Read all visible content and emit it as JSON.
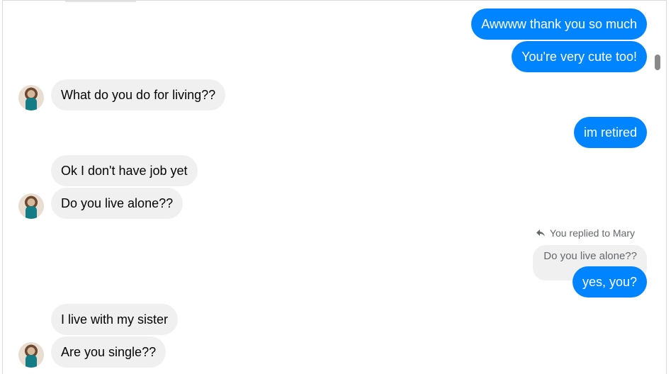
{
  "messages": {
    "m1": "Awwww thank you so much",
    "m2": "You're very cute too!",
    "m3": "What do you do for living??",
    "m4": "im retired",
    "m5": "Ok I don't have job yet",
    "m6": "Do you live alone??",
    "m7": "yes, you?",
    "m8": "I live with my sister",
    "m9": "Are you single??"
  },
  "reply": {
    "note": "You replied to Mary",
    "quoted": "Do you live alone??"
  },
  "colors": {
    "outgoing": "#0084ff",
    "incoming": "#f0f0f0",
    "text_dark": "#050505",
    "text_muted": "#65676b"
  }
}
